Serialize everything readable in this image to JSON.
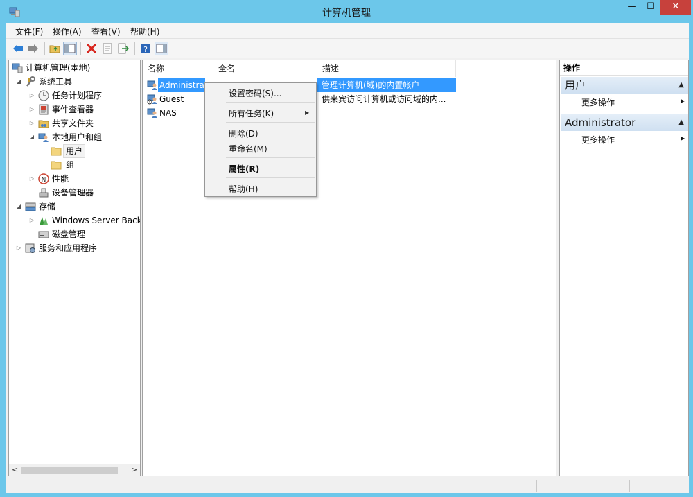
{
  "window": {
    "title": "计算机管理",
    "minimize": "—",
    "maximize": "☐",
    "close": "✕"
  },
  "menubar": {
    "items": [
      "文件(F)",
      "操作(A)",
      "查看(V)",
      "帮助(H)"
    ]
  },
  "toolbar": {
    "buttons": [
      "back-icon",
      "forward-icon",
      "up-folder-icon",
      "show-hide-tree-icon",
      "delete-icon",
      "properties-icon",
      "export-icon",
      "help-icon",
      "show-hide-action-pane-icon"
    ]
  },
  "tree": {
    "items": [
      {
        "label": "计算机管理(本地)"
      },
      {
        "label": "系统工具"
      },
      {
        "label": "任务计划程序"
      },
      {
        "label": "事件查看器"
      },
      {
        "label": "共享文件夹"
      },
      {
        "label": "本地用户和组"
      },
      {
        "label": "用户"
      },
      {
        "label": "组"
      },
      {
        "label": "性能"
      },
      {
        "label": "设备管理器"
      },
      {
        "label": "存储"
      },
      {
        "label": "Windows Server Back"
      },
      {
        "label": "磁盘管理"
      },
      {
        "label": "服务和应用程序"
      }
    ]
  },
  "list": {
    "columns": [
      "名称",
      "全名",
      "描述"
    ],
    "rows": [
      {
        "name": "Administrat",
        "fullname": "",
        "desc": "管理计算机(域)的内置帐户",
        "selected": true
      },
      {
        "name": "Guest",
        "fullname": "",
        "desc": "供来宾访问计算机或访问域的内..."
      },
      {
        "name": "NAS",
        "fullname": "",
        "desc": ""
      }
    ]
  },
  "context_menu": {
    "items": [
      "设置密码(S)...",
      "所有任务(K)",
      "删除(D)",
      "重命名(M)",
      "属性(R)",
      "帮助(H)"
    ]
  },
  "actions": {
    "title": "操作",
    "sections": [
      {
        "label": "用户",
        "items": [
          "更多操作"
        ]
      },
      {
        "label": "Administrator",
        "items": [
          "更多操作"
        ]
      }
    ]
  },
  "colors": {
    "frame": "#6cc7ea",
    "selection": "#3399ff",
    "close_button": "#c7413c"
  }
}
